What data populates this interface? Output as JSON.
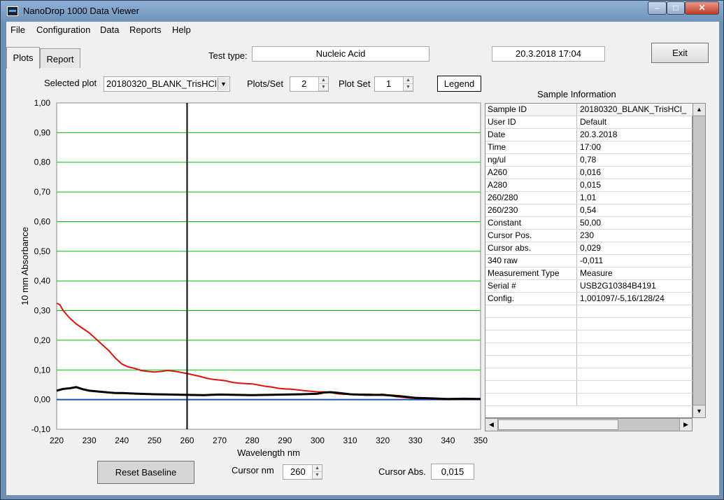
{
  "window": {
    "title": "NanoDrop 1000 Data Viewer",
    "controls": {
      "minimize": "–",
      "maximize": "□",
      "close": "✕"
    }
  },
  "menu": [
    "File",
    "Configuration",
    "Data",
    "Reports",
    "Help"
  ],
  "tabs": [
    {
      "label": "Plots",
      "active": true
    },
    {
      "label": "Report",
      "active": false
    }
  ],
  "header": {
    "test_type_label": "Test type:",
    "test_type_value": "Nucleic Acid",
    "datetime": "20.3.2018  17:04",
    "exit_label": "Exit"
  },
  "controls": {
    "selected_plot_label": "Selected plot",
    "selected_plot_value": "20180320_BLANK_TrisHCl",
    "plots_per_set_label": "Plots/Set",
    "plots_per_set_value": "2",
    "plot_set_label": "Plot Set",
    "plot_set_value": "1",
    "legend_label": "Legend"
  },
  "sample_info": {
    "title": "Sample Information",
    "rows": [
      {
        "key": "Sample ID",
        "value": "20180320_BLANK_TrisHCl_"
      },
      {
        "key": "User ID",
        "value": "Default"
      },
      {
        "key": "Date",
        "value": "20.3.2018"
      },
      {
        "key": "Time",
        "value": "17:00"
      },
      {
        "key": "ng/ul",
        "value": " 0,78"
      },
      {
        "key": "A260",
        "value": "0,016"
      },
      {
        "key": "A280",
        "value": "0,015"
      },
      {
        "key": "260/280",
        "value": " 1,01"
      },
      {
        "key": "260/230",
        "value": " 0,54"
      },
      {
        "key": "Constant",
        "value": "50,00"
      },
      {
        "key": "Cursor Pos.",
        "value": " 230"
      },
      {
        "key": "Cursor abs.",
        "value": "0,029"
      },
      {
        "key": "340 raw",
        "value": "-0,011"
      },
      {
        "key": "Measurement Type",
        "value": "Measure"
      },
      {
        "key": "Serial #",
        "value": "USB2G10384B4191"
      },
      {
        "key": "Config.",
        "value": "1,001097/-5,16/128/24"
      },
      {
        "key": "",
        "value": ""
      },
      {
        "key": "",
        "value": ""
      },
      {
        "key": "",
        "value": ""
      },
      {
        "key": "",
        "value": ""
      },
      {
        "key": "",
        "value": ""
      },
      {
        "key": "",
        "value": ""
      },
      {
        "key": "",
        "value": ""
      },
      {
        "key": "",
        "value": ""
      }
    ]
  },
  "bottom": {
    "reset_baseline_label": "Reset Baseline",
    "cursor_nm_label": "Cursor nm",
    "cursor_nm_value": "260",
    "cursor_abs_label": "Cursor Abs.",
    "cursor_abs_value": "0,015"
  },
  "chart_data": {
    "type": "line",
    "xlabel": "Wavelength nm",
    "ylabel": "10 mm Absorbance",
    "xlim": [
      220,
      350
    ],
    "ylim": [
      -0.1,
      1.0
    ],
    "x_ticks": [
      "220",
      "230",
      "240",
      "250",
      "260",
      "270",
      "280",
      "290",
      "300",
      "310",
      "320",
      "330",
      "340",
      "350"
    ],
    "y_ticks": [
      "1,00",
      "0,90",
      "0,80",
      "0,70",
      "0,60",
      "0,50",
      "0,40",
      "0,30",
      "0,20",
      "0,10",
      "0,00",
      "-0,10"
    ],
    "grid": true,
    "grid_color": "#00c000",
    "cursor_x": 260,
    "zero_line_color": "#1f4fb0",
    "series": [
      {
        "color": "#e01010",
        "x": [
          220,
          221,
          222,
          224,
          226,
          228,
          230,
          232,
          234,
          236,
          238,
          240,
          242,
          244,
          246,
          248,
          250,
          252,
          254,
          256,
          258,
          260,
          262,
          264,
          266,
          268,
          270,
          272,
          274,
          276,
          278,
          280,
          282,
          284,
          286,
          288,
          290,
          292,
          294,
          296,
          298,
          300,
          302,
          304,
          306,
          308,
          310,
          312,
          314,
          316,
          318,
          320,
          322,
          324,
          326,
          328,
          330,
          332,
          334,
          336,
          338,
          340,
          342,
          344,
          346,
          348,
          350
        ],
        "y": [
          0.325,
          0.32,
          0.3,
          0.275,
          0.255,
          0.24,
          0.225,
          0.205,
          0.185,
          0.165,
          0.14,
          0.12,
          0.11,
          0.105,
          0.098,
          0.095,
          0.093,
          0.095,
          0.098,
          0.096,
          0.092,
          0.088,
          0.083,
          0.078,
          0.072,
          0.068,
          0.066,
          0.063,
          0.058,
          0.055,
          0.054,
          0.053,
          0.049,
          0.045,
          0.042,
          0.038,
          0.036,
          0.035,
          0.033,
          0.03,
          0.028,
          0.026,
          0.026,
          0.024,
          0.02,
          0.018,
          0.018,
          0.017,
          0.018,
          0.018,
          0.016,
          0.018,
          0.014,
          0.01,
          0.008,
          0.006,
          0.004,
          0.004,
          0.003,
          0.004,
          0.002,
          0.0,
          0.001,
          0.002,
          0.001,
          0.002,
          0.001
        ]
      },
      {
        "color": "#000000",
        "x": [
          220,
          222,
          224,
          226,
          228,
          230,
          232,
          234,
          236,
          238,
          240,
          245,
          250,
          255,
          260,
          265,
          270,
          275,
          280,
          285,
          290,
          295,
          300,
          302,
          304,
          306,
          310,
          315,
          320,
          325,
          330,
          335,
          340,
          345,
          350
        ],
        "y": [
          0.03,
          0.036,
          0.038,
          0.042,
          0.035,
          0.03,
          0.028,
          0.026,
          0.024,
          0.022,
          0.022,
          0.02,
          0.018,
          0.017,
          0.016,
          0.015,
          0.017,
          0.016,
          0.015,
          0.016,
          0.017,
          0.018,
          0.02,
          0.024,
          0.025,
          0.023,
          0.018,
          0.016,
          0.016,
          0.012,
          0.006,
          0.004,
          0.002,
          0.003,
          0.002
        ]
      }
    ]
  }
}
